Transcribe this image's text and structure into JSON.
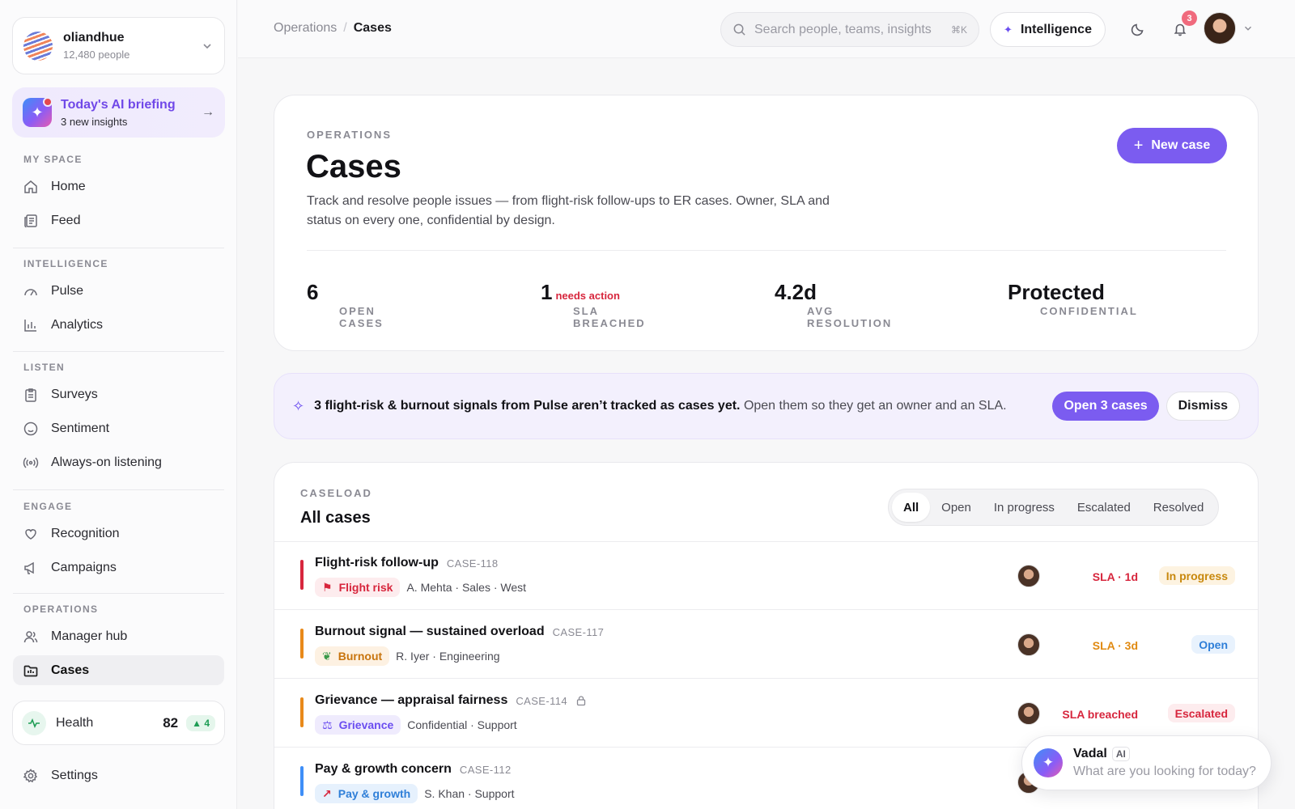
{
  "org": {
    "name": "oliandhue",
    "people": "12,480 people"
  },
  "briefing": {
    "title": "Today's AI briefing",
    "subtitle": "3 new insights"
  },
  "nav": {
    "my_space": {
      "heading": "MY SPACE",
      "items": [
        "Home",
        "Feed"
      ]
    },
    "intelligence": {
      "heading": "INTELLIGENCE",
      "items": [
        "Pulse",
        "Analytics"
      ]
    },
    "listen": {
      "heading": "LISTEN",
      "items": [
        "Surveys",
        "Sentiment",
        "Always-on listening"
      ]
    },
    "engage": {
      "heading": "ENGAGE",
      "items": [
        "Recognition",
        "Campaigns"
      ]
    },
    "operations": {
      "heading": "OPERATIONS",
      "items": [
        "Manager hub",
        "Cases"
      ]
    }
  },
  "health": {
    "label": "Health",
    "score": "82",
    "delta": "▲ 4"
  },
  "settings_label": "Settings",
  "topbar": {
    "breadcrumb": [
      "Operations",
      "/",
      "Cases"
    ],
    "search_placeholder": "Search people, teams, insights",
    "search_shortcut": "⌘K",
    "intelligence_label": "Intelligence",
    "notifications_count": "3"
  },
  "hero": {
    "eyebrow": "OPERATIONS",
    "title": "Cases",
    "description": "Track and resolve people issues — from flight-risk follow-ups to ER cases. Owner, SLA and status on every one, confidential by design.",
    "new_case_label": "New case",
    "stats": [
      {
        "label": "OPEN CASES",
        "value": "6",
        "extra": ""
      },
      {
        "label": "SLA BREACHED",
        "value": "1",
        "extra": "needs action"
      },
      {
        "label": "AVG RESOLUTION",
        "value": "4.2d",
        "extra": ""
      },
      {
        "label": "CONFIDENTIAL",
        "value": "Protected",
        "extra": ""
      }
    ]
  },
  "signal": {
    "strong": "3 flight-risk & burnout signals from Pulse aren’t tracked as cases yet.",
    "rest": "Open them so they get an owner and an SLA.",
    "primary_label": "Open 3 cases",
    "secondary_label": "Dismiss"
  },
  "caseload": {
    "eyebrow": "CASELOAD",
    "title": "All cases",
    "filters": [
      "All",
      "Open",
      "In progress",
      "Escalated",
      "Resolved"
    ],
    "active_filter": "All",
    "rows": [
      {
        "title": "Flight-risk follow-up",
        "id": "CASE-118",
        "tag": "Flight risk",
        "tag_icon": "flag-icon",
        "meta": "A. Mehta · Sales · West",
        "sla": "SLA · 1d",
        "status": "In progress",
        "bar_color": "#d7263d",
        "sla_color": "#d7263d"
      },
      {
        "title": "Burnout signal — sustained overload",
        "id": "CASE-117",
        "tag": "Burnout",
        "tag_icon": "leaf-icon",
        "meta": "R. Iyer · Engineering",
        "sla": "SLA · 3d",
        "status": "Open",
        "bar_color": "#e8891a",
        "sla_color": "#e08a12"
      },
      {
        "title": "Grievance — appraisal fairness",
        "id": "CASE-114",
        "tag": "Grievance",
        "tag_icon": "scale-icon",
        "meta": "Confidential · Support",
        "sla": "SLA breached",
        "status": "Escalated",
        "bar_color": "#e8891a",
        "sla_color": "#d7263d"
      },
      {
        "title": "Pay & growth concern",
        "id": "CASE-112",
        "tag": "Pay & growth",
        "tag_icon": "chart-up-icon",
        "meta": "S. Khan · Support",
        "sla": "",
        "status": "",
        "bar_color": "#3e8ef7",
        "sla_color": "#2f7fd8"
      }
    ]
  },
  "assistant": {
    "name": "Vadal",
    "badge": "AI",
    "prompt": "What are you looking for today?"
  }
}
